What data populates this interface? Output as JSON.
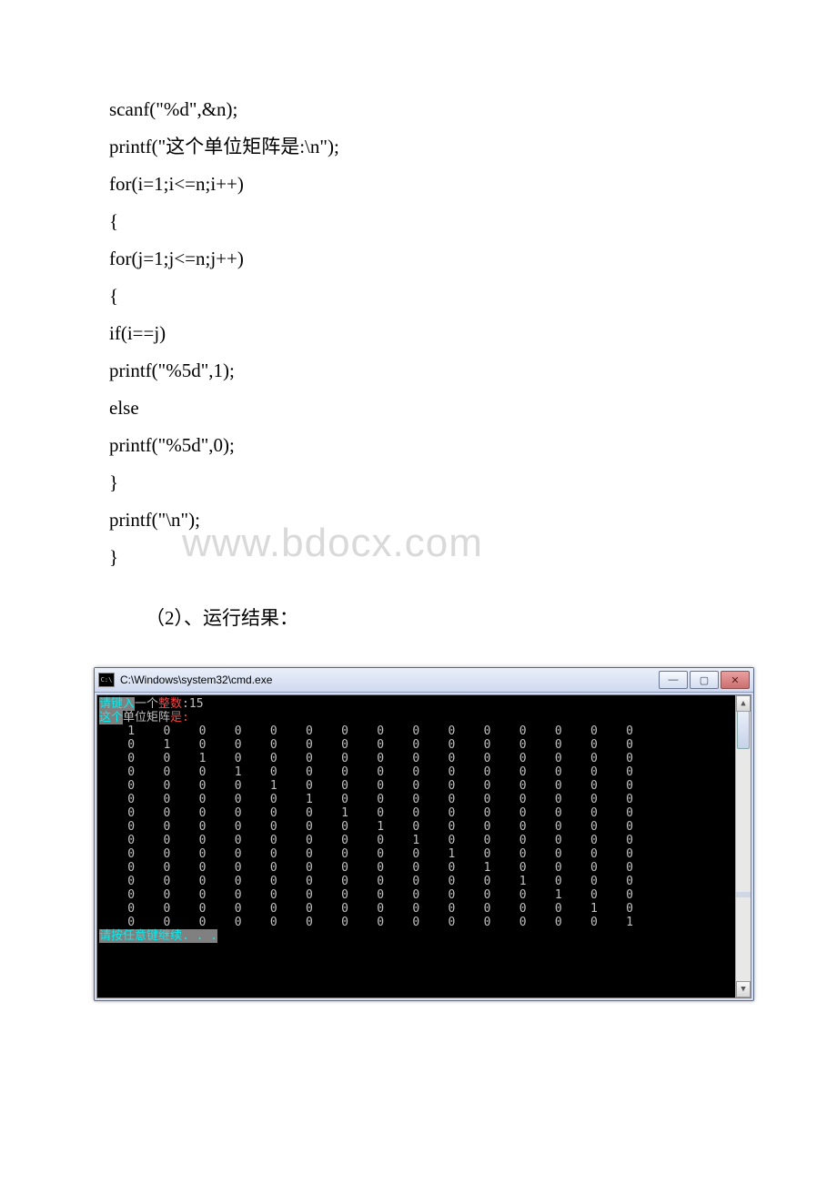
{
  "code": {
    "l1": "scanf(\"%d\",&n);",
    "l2": "printf(\"这个单位矩阵是:\\n\");",
    "l3": "for(i=1;i<=n;i++)",
    "l4": "{",
    "l5": "for(j=1;j<=n;j++)",
    "l6": "{",
    "l7": "if(i==j)",
    "l8": "printf(\"%5d\",1);",
    "l9": "else",
    "l10": "printf(\"%5d\",0);",
    "l11": "}",
    "l12": "printf(\"\\n\");",
    "l13": "}"
  },
  "watermark": "www.bdocx.com",
  "section_label": "（2）、运行结果：",
  "console": {
    "title": "C:\\Windows\\system32\\cmd.exe",
    "btn_min": "—",
    "btn_max": "▢",
    "btn_close": "✕",
    "prompt1_pre": "请键入",
    "prompt1_mid": "一个",
    "prompt1_suf": "整数",
    "prompt1_val": ":15",
    "prompt2_a": "这个",
    "prompt2_b": "单位矩阵",
    "prompt2_c": "是:",
    "matrix_n": 15,
    "press_any": "请按任意键继续. . ."
  },
  "chart_data": {
    "type": "table",
    "title": "15x15 identity matrix output",
    "n": 15,
    "rows": [
      [
        1,
        0,
        0,
        0,
        0,
        0,
        0,
        0,
        0,
        0,
        0,
        0,
        0,
        0,
        0
      ],
      [
        0,
        1,
        0,
        0,
        0,
        0,
        0,
        0,
        0,
        0,
        0,
        0,
        0,
        0,
        0
      ],
      [
        0,
        0,
        1,
        0,
        0,
        0,
        0,
        0,
        0,
        0,
        0,
        0,
        0,
        0,
        0
      ],
      [
        0,
        0,
        0,
        1,
        0,
        0,
        0,
        0,
        0,
        0,
        0,
        0,
        0,
        0,
        0
      ],
      [
        0,
        0,
        0,
        0,
        1,
        0,
        0,
        0,
        0,
        0,
        0,
        0,
        0,
        0,
        0
      ],
      [
        0,
        0,
        0,
        0,
        0,
        1,
        0,
        0,
        0,
        0,
        0,
        0,
        0,
        0,
        0
      ],
      [
        0,
        0,
        0,
        0,
        0,
        0,
        1,
        0,
        0,
        0,
        0,
        0,
        0,
        0,
        0
      ],
      [
        0,
        0,
        0,
        0,
        0,
        0,
        0,
        1,
        0,
        0,
        0,
        0,
        0,
        0,
        0
      ],
      [
        0,
        0,
        0,
        0,
        0,
        0,
        0,
        0,
        1,
        0,
        0,
        0,
        0,
        0,
        0
      ],
      [
        0,
        0,
        0,
        0,
        0,
        0,
        0,
        0,
        0,
        1,
        0,
        0,
        0,
        0,
        0
      ],
      [
        0,
        0,
        0,
        0,
        0,
        0,
        0,
        0,
        0,
        0,
        1,
        0,
        0,
        0,
        0
      ],
      [
        0,
        0,
        0,
        0,
        0,
        0,
        0,
        0,
        0,
        0,
        0,
        1,
        0,
        0,
        0
      ],
      [
        0,
        0,
        0,
        0,
        0,
        0,
        0,
        0,
        0,
        0,
        0,
        0,
        1,
        0,
        0
      ],
      [
        0,
        0,
        0,
        0,
        0,
        0,
        0,
        0,
        0,
        0,
        0,
        0,
        0,
        1,
        0
      ],
      [
        0,
        0,
        0,
        0,
        0,
        0,
        0,
        0,
        0,
        0,
        0,
        0,
        0,
        0,
        1
      ]
    ]
  }
}
